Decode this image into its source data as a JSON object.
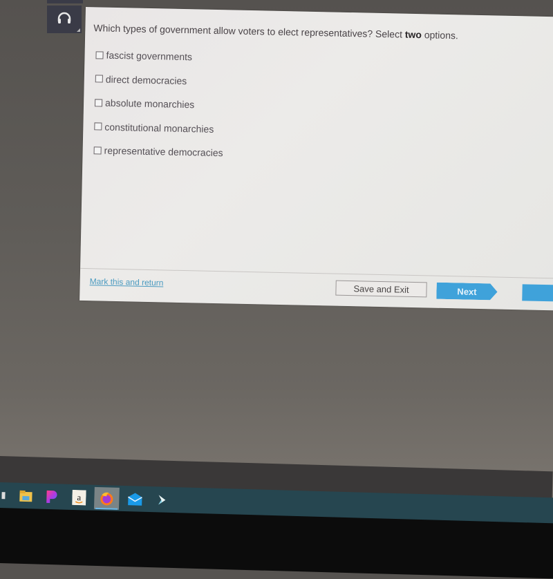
{
  "question": {
    "prefix": "Which types of government allow voters to elect representatives? Select ",
    "emphasis": "two",
    "suffix": " options."
  },
  "options": [
    {
      "label": "fascist governments",
      "checked": false
    },
    {
      "label": "direct democracies",
      "checked": false
    },
    {
      "label": "absolute monarchies",
      "checked": false
    },
    {
      "label": "constitutional monarchies",
      "checked": false
    },
    {
      "label": "representative democracies",
      "checked": false
    }
  ],
  "footer": {
    "mark_link": "Mark this and return",
    "save_exit": "Save and Exit",
    "next": "Next"
  },
  "sidebar": {
    "audio_icon": "headphones-icon"
  },
  "taskbar": {
    "icons": [
      "file-explorer-icon",
      "picsart-icon",
      "amazon-icon",
      "firefox-icon",
      "mail-icon",
      "app-arrow-icon"
    ],
    "active": "firefox-icon"
  },
  "colors": {
    "accent": "#3fa2da",
    "link": "#4a9ac0",
    "taskbar": "#264650"
  }
}
